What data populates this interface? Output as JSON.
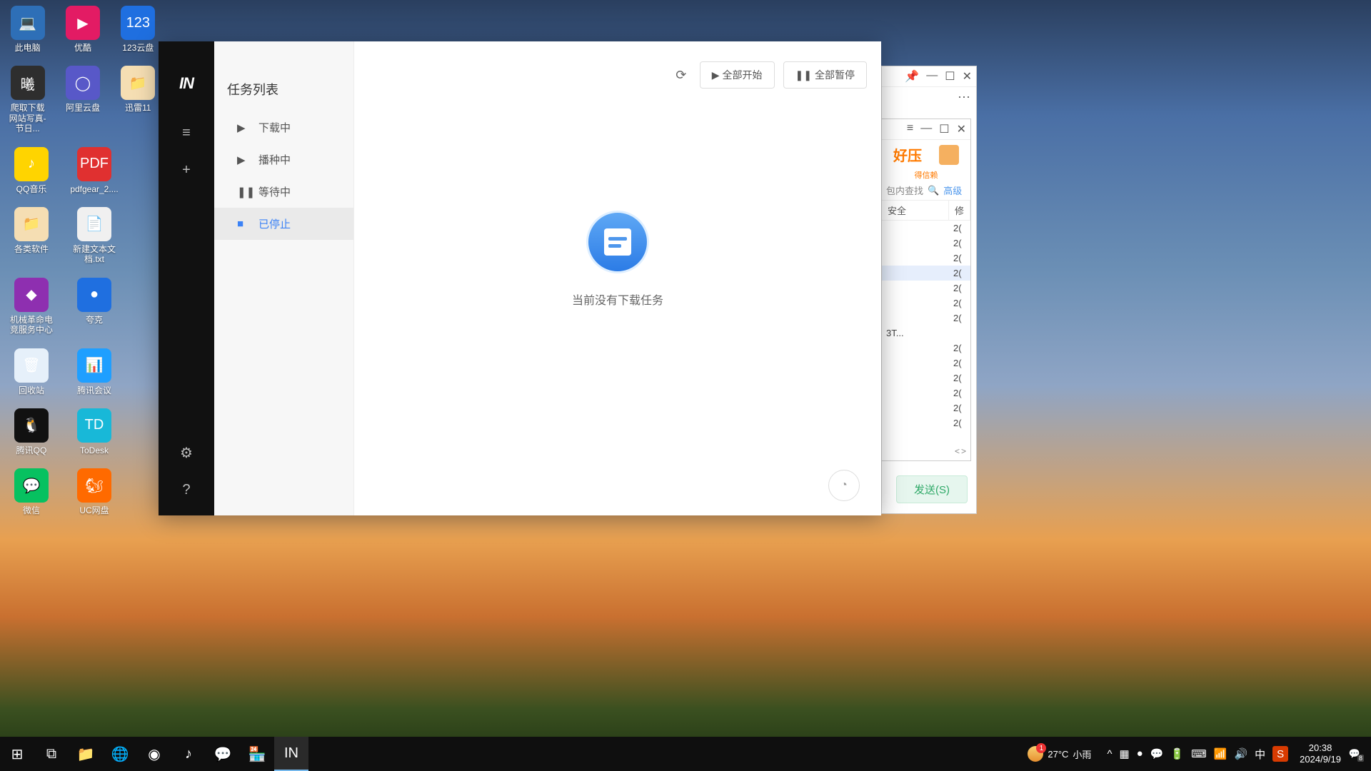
{
  "desktop": {
    "rows": [
      [
        {
          "label": "此电脑",
          "bg": "#2e6fb7",
          "glyph": "💻"
        },
        {
          "label": "优酷",
          "bg": "#e31b64",
          "glyph": "▶"
        },
        {
          "label": "123云盘",
          "bg": "#1f6fe0",
          "glyph": "123"
        }
      ],
      [
        {
          "label": "爬取下载网站写真-节日...",
          "bg": "#2e2e2e",
          "glyph": "曦"
        },
        {
          "label": "阿里云盘",
          "bg": "#5858c8",
          "glyph": "◯"
        },
        {
          "label": "迅雷11",
          "bg": "#f5deb3",
          "glyph": "📁"
        }
      ],
      [
        {
          "label": "QQ音乐",
          "bg": "#ffd400",
          "glyph": "♪"
        },
        {
          "label": "pdfgear_2....",
          "bg": "#e03030",
          "glyph": "PDF"
        }
      ],
      [
        {
          "label": "各类软件",
          "bg": "#f5deb3",
          "glyph": "📁"
        },
        {
          "label": "新建文本文档.txt",
          "bg": "#f0f0f0",
          "glyph": "📄"
        }
      ],
      [
        {
          "label": "机械革命电竞服务中心",
          "bg": "#8e2fb0",
          "glyph": "◆"
        },
        {
          "label": "夸克",
          "bg": "#1f6fe0",
          "glyph": "●"
        }
      ],
      [
        {
          "label": "回收站",
          "bg": "#e6f0fa",
          "glyph": "🗑"
        },
        {
          "label": "腾讯会议",
          "bg": "#1f9fff",
          "glyph": "📊"
        }
      ],
      [
        {
          "label": "腾讯QQ",
          "bg": "#111",
          "glyph": "🐧"
        },
        {
          "label": "ToDesk",
          "bg": "#18b8d8",
          "glyph": "TD"
        }
      ],
      [
        {
          "label": "微信",
          "bg": "#07c160",
          "glyph": "💬"
        },
        {
          "label": "UC网盘",
          "bg": "#ff6a00",
          "glyph": "🐿"
        }
      ]
    ]
  },
  "app": {
    "wctrl": {
      "min": "—",
      "max": "⤢",
      "close": "✕"
    },
    "sidebar": {
      "logo": "IN",
      "menu": "≡",
      "add": "+",
      "settings": "⚙",
      "help": "?"
    },
    "list": {
      "title": "任务列表",
      "items": [
        {
          "glyph": "▶",
          "label": "下载中",
          "key": "downloading"
        },
        {
          "glyph": "▶",
          "label": "播种中",
          "key": "seeding"
        },
        {
          "glyph": "❚❚",
          "label": "等待中",
          "key": "waiting"
        },
        {
          "glyph": "■",
          "label": "已停止",
          "key": "stopped"
        }
      ],
      "active": "stopped"
    },
    "toolbar": {
      "refresh": "⟳",
      "start_all": {
        "glyph": "▶",
        "label": "全部开始"
      },
      "pause_all": {
        "glyph": "❚❚",
        "label": "全部暂停"
      }
    },
    "empty": "当前没有下载任务",
    "speed_glyph": "◔"
  },
  "bgwin1": {
    "pin": "📌",
    "min": "—",
    "max": "☐",
    "close": "✕",
    "more": "⋯",
    "send": "发送(S)"
  },
  "bgwin2": {
    "menu": "≡",
    "min": "—",
    "max": "☐",
    "close": "✕",
    "brand": "好压",
    "tagline": "得信赖",
    "search_ph": "包内查找",
    "search_glyph": "🔍",
    "adv": "高级",
    "cols": {
      "c1": "安全",
      "c2": "修"
    },
    "rows": [
      "2(",
      "2(",
      "2(",
      "2(",
      "2(",
      "2(",
      "2(",
      "2(",
      "2(",
      "2(",
      "2(",
      "2(",
      "2("
    ],
    "bt": "3T...",
    "sb_left": "<",
    "sb_right": ">"
  },
  "taskbar": {
    "left": [
      {
        "name": "start",
        "glyph": "⊞"
      },
      {
        "name": "taskview",
        "glyph": "⧉"
      },
      {
        "name": "explorer",
        "glyph": "📁"
      },
      {
        "name": "browser",
        "glyph": "🌐"
      },
      {
        "name": "edge",
        "glyph": "◉"
      },
      {
        "name": "qqmusic",
        "glyph": "♪"
      },
      {
        "name": "wechat",
        "glyph": "💬"
      },
      {
        "name": "app1",
        "glyph": "🏪"
      },
      {
        "name": "motrix",
        "glyph": "IN",
        "active": true
      }
    ],
    "weather": {
      "badge": "1",
      "temp": "27°C",
      "text": "小雨"
    },
    "tray": {
      "chev": "^",
      "items": [
        "▦",
        "●",
        "💬",
        "🔋",
        "⌨",
        "📶",
        "🔊"
      ],
      "ime_lang": "中",
      "ime_badge": "S"
    },
    "clock": {
      "time": "20:38",
      "date": "2024/9/19"
    },
    "notif": {
      "glyph": "💬",
      "badge": "8"
    }
  }
}
